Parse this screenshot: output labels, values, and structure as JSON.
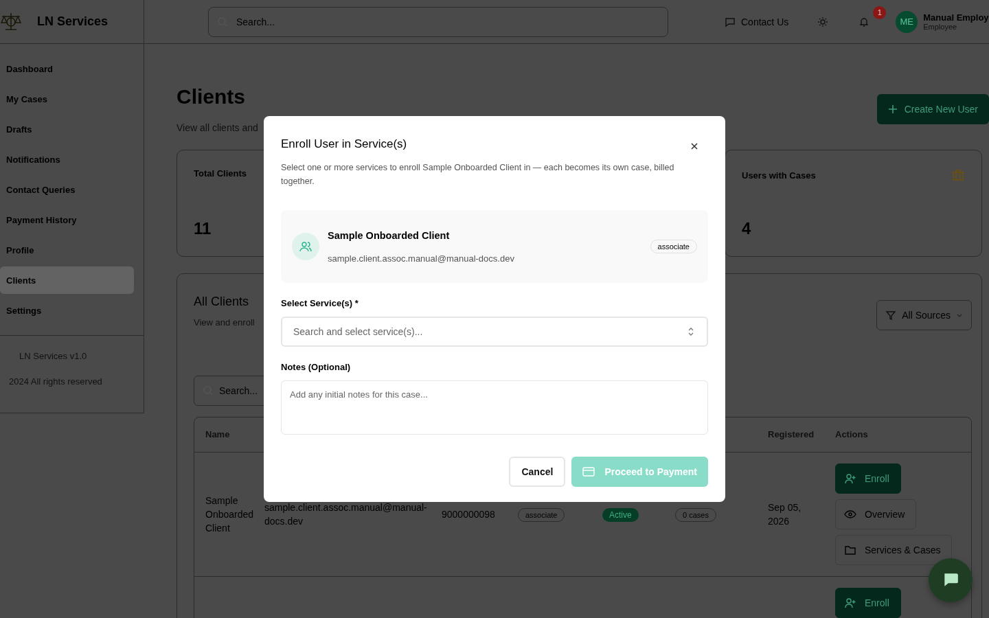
{
  "app": {
    "name": "LN Services"
  },
  "header": {
    "search": {
      "placeholder": "Search..."
    },
    "contact": "Contact Us",
    "notifications_badge": "1",
    "user": {
      "initials": "ME",
      "name": "Manual Employ",
      "role": "Employee"
    }
  },
  "sidebar": {
    "items": [
      {
        "label": "Dashboard",
        "selected": false
      },
      {
        "label": "My Cases",
        "selected": false
      },
      {
        "label": "Drafts",
        "selected": false
      },
      {
        "label": "Notifications",
        "selected": false
      },
      {
        "label": "Contact Queries",
        "selected": false
      },
      {
        "label": "Payment History",
        "selected": false
      },
      {
        "label": "Profile",
        "selected": false
      },
      {
        "label": "Clients",
        "selected": true
      },
      {
        "label": "Settings",
        "selected": false
      }
    ],
    "version": "LN Services v1.0",
    "copyright": "2024 All rights reserved"
  },
  "page": {
    "title": "Clients",
    "subtitle": "View all clients and",
    "create_button": "Create New User"
  },
  "stats": {
    "first": {
      "label": "Total Clients",
      "value": "11"
    },
    "last": {
      "label": "Users with Cases",
      "value": "4"
    }
  },
  "clients_panel": {
    "title": "All Clients",
    "subtitle": "View and enroll",
    "filter": "All Sources",
    "search": {
      "placeholder": "Search..."
    },
    "table": {
      "columns": {
        "name": "Name",
        "registered": "Registered",
        "actions": "Actions"
      },
      "rows": [
        {
          "name": "Sample Onboarded Client",
          "email": "sample.client.assoc.manual@manual-docs.dev",
          "phone": "9000000098",
          "role": "associate",
          "status": "Active",
          "cases": "0 cases",
          "registered": "Sep 05, 2026",
          "actions": [
            {
              "kind": "enroll",
              "label": "Enroll"
            },
            {
              "kind": "overview",
              "label": "Overview"
            },
            {
              "kind": "services",
              "label": "Services & Cases"
            }
          ]
        },
        {
          "actions": [
            {
              "kind": "enroll",
              "label": "Enroll"
            }
          ]
        }
      ]
    }
  },
  "modal": {
    "title": "Enroll User in Service(s)",
    "description": "Select one or more services to enroll Sample Onboarded Client in — each becomes its own case, billed together.",
    "client": {
      "name": "Sample Onboarded Client",
      "email": "sample.client.assoc.manual@manual-docs.dev",
      "role": "associate"
    },
    "service_label": "Select Service(s) *",
    "service_placeholder": "Search and select service(s)...",
    "notes_label": "Notes (Optional)",
    "notes_placeholder": "Add any initial notes for this case...",
    "cancel": "Cancel",
    "proceed": {
      "label": "Proceed to Payment",
      "disabled": true
    }
  }
}
